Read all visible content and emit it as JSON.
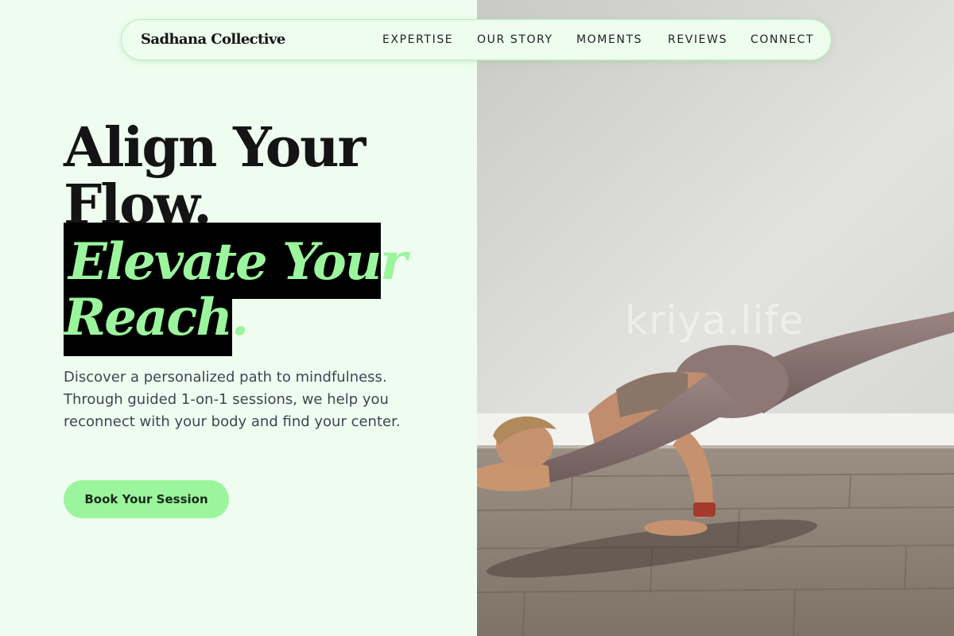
{
  "nav": {
    "brand": "Sadhana Collective",
    "links": [
      "EXPERTISE",
      "OUR STORY",
      "MOMENTS",
      "REVIEWS",
      "CONNECT"
    ]
  },
  "hero": {
    "headline_line1": "Align Your",
    "headline_line2": "Flow.",
    "highlight_line1": "Elevate Your",
    "highlight_line2": "Reach.",
    "description": "Discover a personalized path to mindfulness. Through guided 1-on-1 sessions, we help you reconnect with your body and find your center.",
    "cta_label": "Book Your Session"
  },
  "photo": {
    "watermark": "kriya.life",
    "subject": "yoga practitioner in an arm-balance pose on a wooden floor"
  },
  "colors": {
    "page_background": "#effdf0",
    "accent_green": "#9bf59d",
    "highlight_black": "#000000",
    "text_dark": "#141414",
    "text_body": "#3c4654"
  }
}
